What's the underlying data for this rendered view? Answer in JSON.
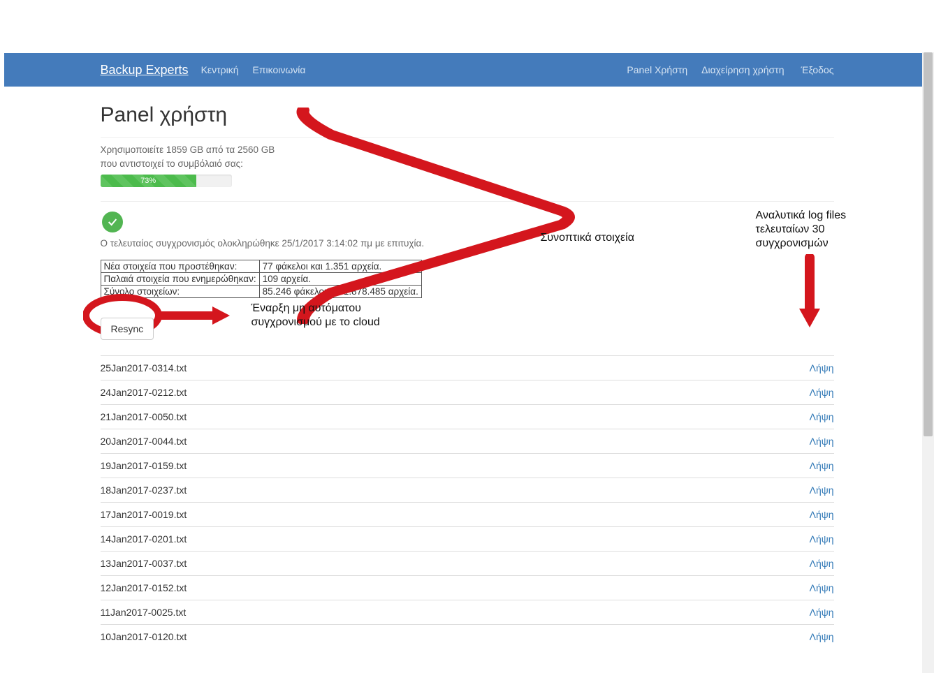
{
  "nav": {
    "brand": "Backup Experts",
    "central": "Κεντρική",
    "contact": "Επικοινωνία",
    "panel_user": "Panel Χρήστη",
    "manage_user": "Διαχείρηση χρήστη",
    "user_email": "",
    "logout": "Έξοδος"
  },
  "page_title": "Panel χρήστη",
  "usage": {
    "line1": "Χρησιμοποιείτε 1859 GB από τα 2560 GB",
    "line2": "που αντιστοιχεί το συμβόλαιό σας:",
    "percent_label": "73%",
    "percent_value": 73
  },
  "sync": {
    "status_text": "Ο τελευταίος συγχρονισμός ολοκληρώθηκε 25/1/2017 3:14:02 πμ με επιτυχία.",
    "rows": [
      {
        "label": "Νέα στοιχεία που προστέθηκαν:",
        "value": "77 φάκελοι και 1.351 αρχεία."
      },
      {
        "label": "Παλαιά στοιχεία που ενημερώθηκαν:",
        "value": "109 αρχεία."
      },
      {
        "label": "Σύνολο στοιχείων:",
        "value": "85.246 φάκελοι και 1.878.485 αρχεία."
      }
    ]
  },
  "resync_label": "Resync",
  "download_label": "Λήψη",
  "logs": [
    "25Jan2017-0314.txt",
    "24Jan2017-0212.txt",
    "21Jan2017-0050.txt",
    "20Jan2017-0044.txt",
    "19Jan2017-0159.txt",
    "18Jan2017-0237.txt",
    "17Jan2017-0019.txt",
    "14Jan2017-0201.txt",
    "13Jan2017-0037.txt",
    "12Jan2017-0152.txt",
    "11Jan2017-0025.txt",
    "10Jan2017-0120.txt"
  ],
  "annotations": {
    "summary": "Συνοπτικά στοιχεία",
    "resync": "Έναρξη μη αυτόματου συγχρονισμού με το cloud",
    "logs": "Αναλυτικά log files τελευταίων 30 συγχρονισμών"
  }
}
